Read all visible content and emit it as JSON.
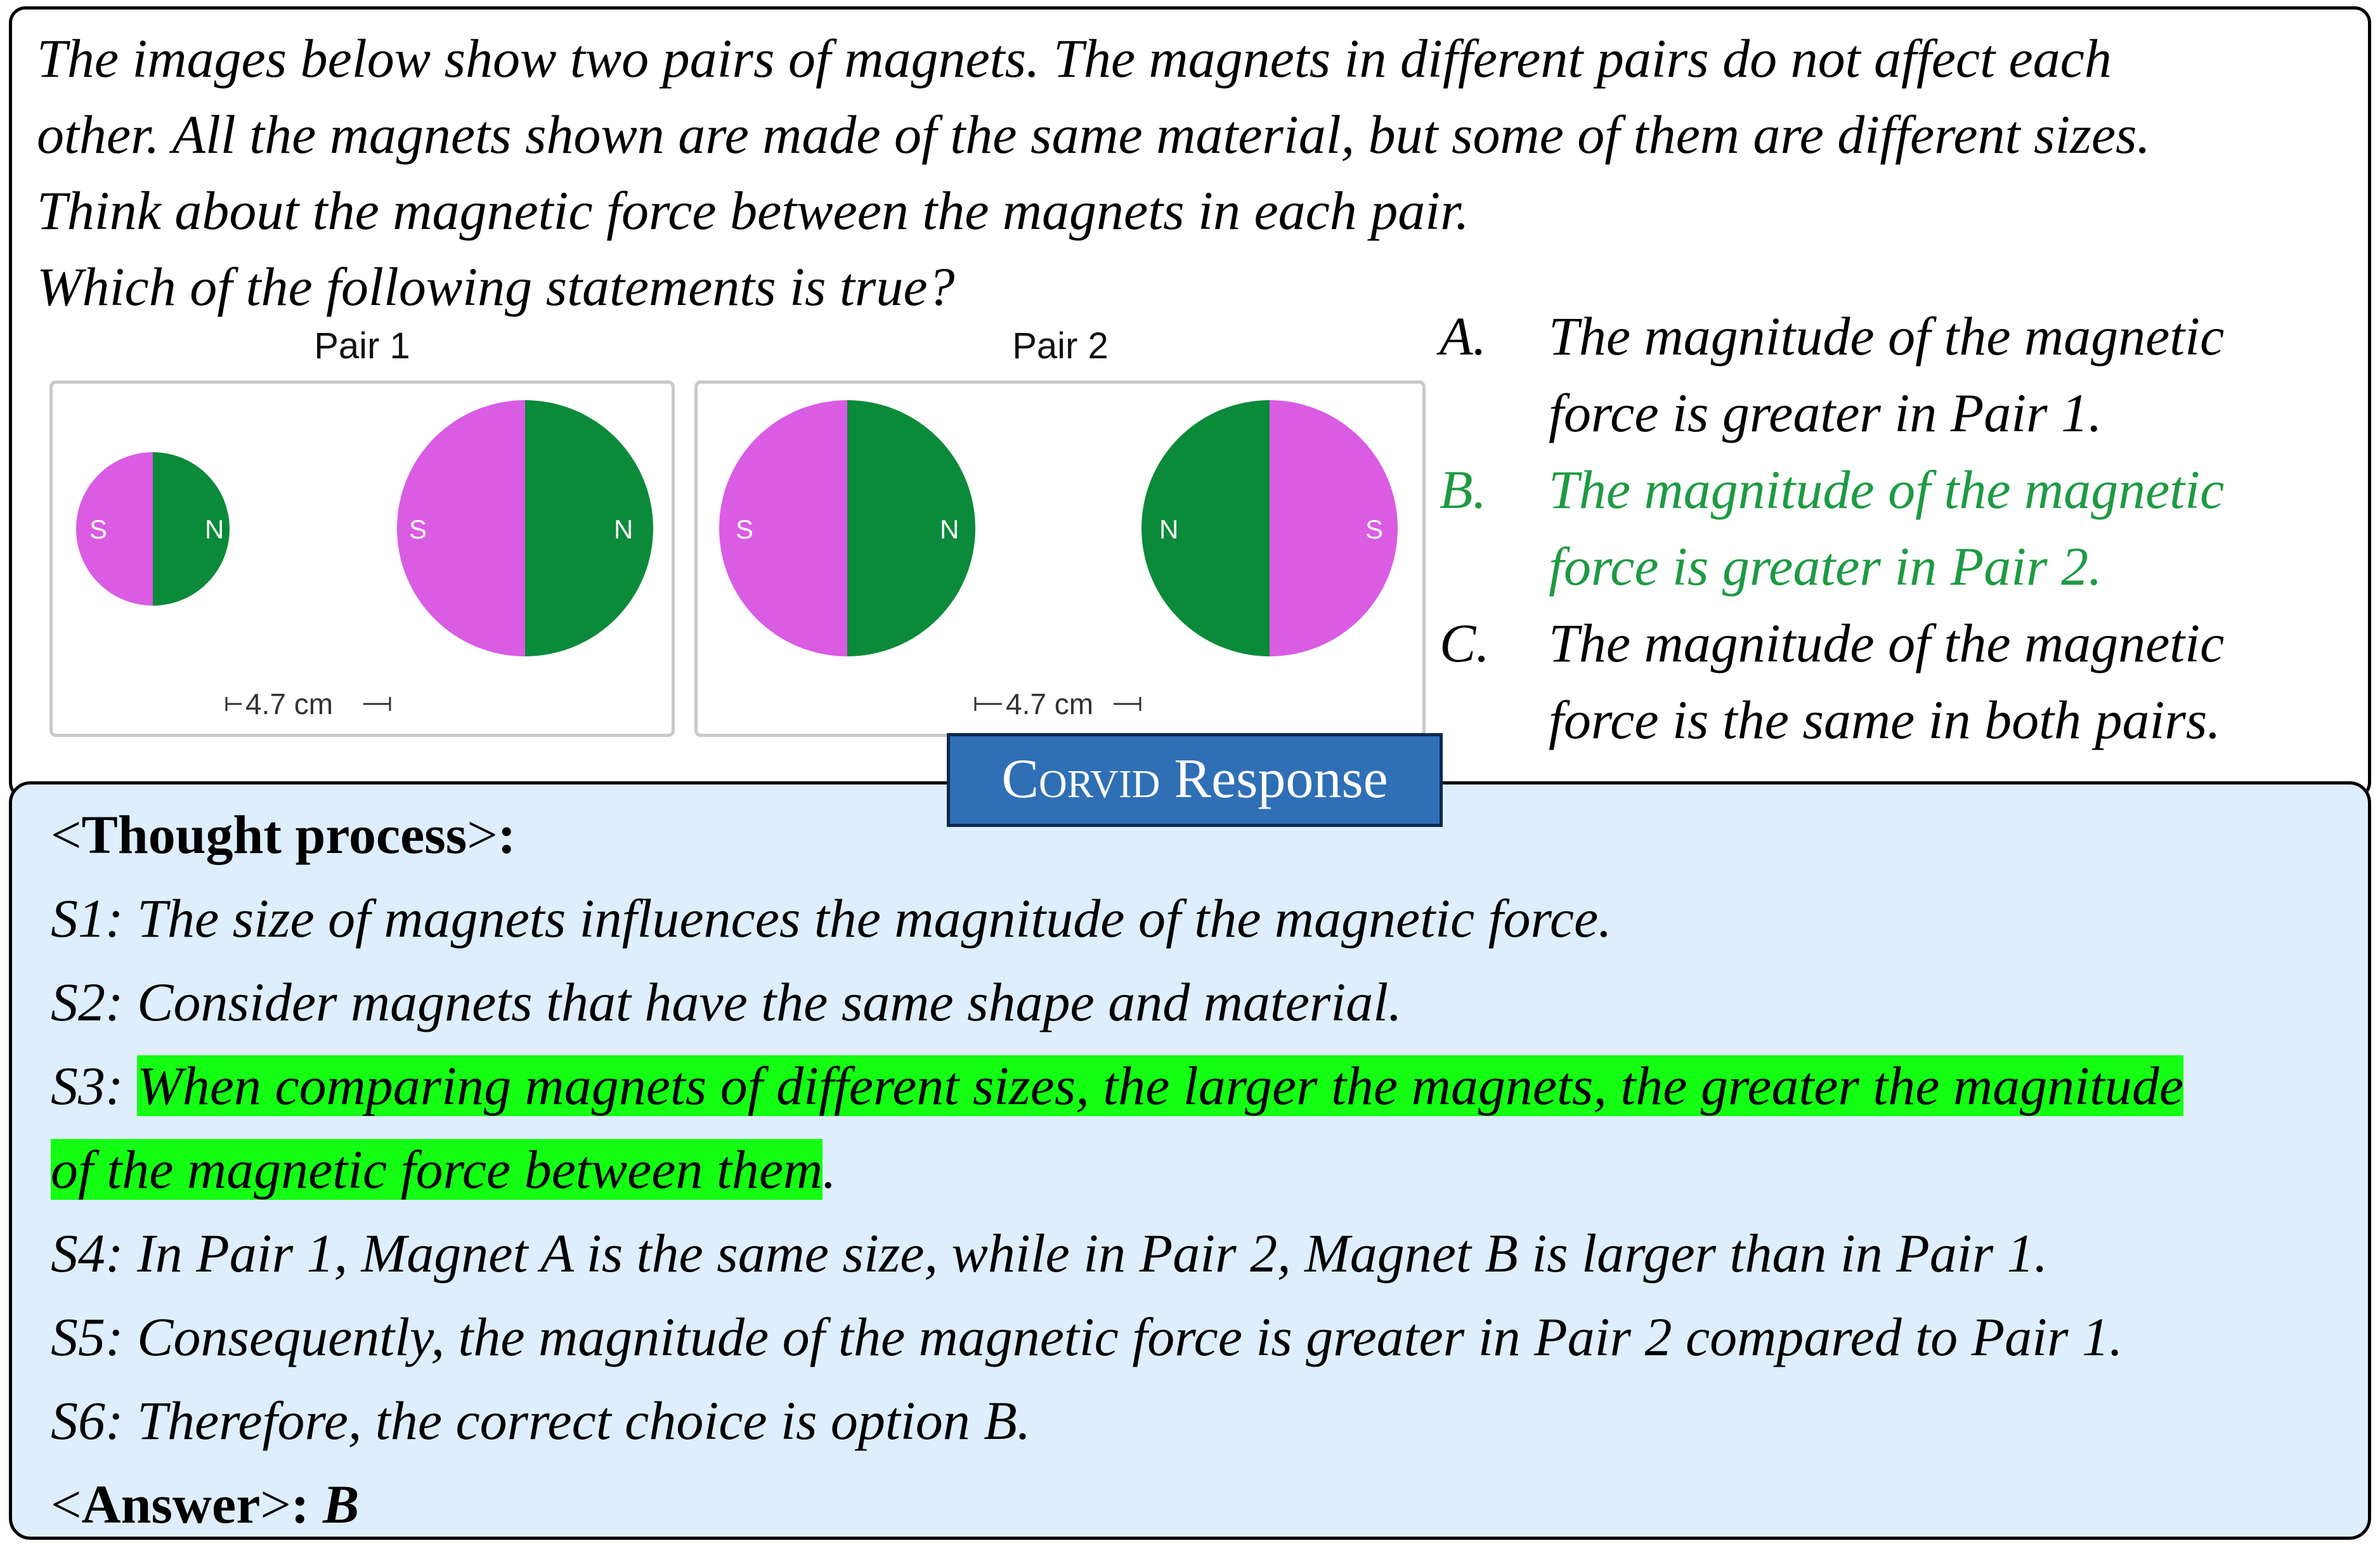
{
  "question": {
    "lines": [
      "The images below show two pairs of magnets. The magnets in different pairs do not affect each",
      "other. All the magnets shown are made of the same material, but some of them are different sizes.",
      "Think about the magnetic force between the magnets in each pair.",
      "Which of the following statements is true?"
    ]
  },
  "figure": {
    "pair1": {
      "title": "Pair 1",
      "distance": "4.7 cm",
      "magnet_left": {
        "left_pole": "S",
        "right_pole": "N",
        "size": "small"
      },
      "magnet_right": {
        "left_pole": "S",
        "right_pole": "N",
        "size": "large"
      }
    },
    "pair2": {
      "title": "Pair 2",
      "distance": "4.7 cm",
      "magnet_left": {
        "left_pole": "S",
        "right_pole": "N",
        "size": "large"
      },
      "magnet_right": {
        "left_pole": "N",
        "right_pole": "S",
        "size": "large"
      }
    },
    "colors": {
      "south_pole": "#d95ce3",
      "north_pole": "#0b8a3a"
    }
  },
  "options": [
    {
      "letter": "A.",
      "line1": "The magnitude of the magnetic",
      "line2": "force is greater in Pair 1."
    },
    {
      "letter": "B.",
      "line1": "The magnitude of the magnetic",
      "line2": "force is greater in Pair 2."
    },
    {
      "letter": "C.",
      "line1": "The magnitude of the magnetic",
      "line2": "force is the same in both pairs."
    }
  ],
  "correct_option_color": "#1e9a43",
  "badge": {
    "brand": "Corvid",
    "label": "Response"
  },
  "response": {
    "thought_label": "Thought process",
    "s1": {
      "id": "S1:",
      "text": "The size of magnets influences the magnitude of the magnetic force."
    },
    "s2": {
      "id": "S2:",
      "text": "Consider magnets that have the same shape and material."
    },
    "s3": {
      "id": "S3:",
      "highlight1": "When comparing magnets of different sizes, the larger the magnets, the greater the magnitude",
      "highlight2": "of the magnetic force between them",
      "tail": "."
    },
    "s4": {
      "id": "S4:",
      "text": "In Pair 1, Magnet A is the same size, while in Pair 2, Magnet B is larger than in Pair 1."
    },
    "s5": {
      "id": "S5:",
      "text": "Consequently, the magnitude of the magnetic force is greater in Pair 2 compared to Pair 1."
    },
    "s6": {
      "id": "S6:",
      "text": "Therefore, the correct choice is option B."
    },
    "answer_label": "Answer",
    "answer_value": "B",
    "highlight_color": "#14ff14"
  }
}
